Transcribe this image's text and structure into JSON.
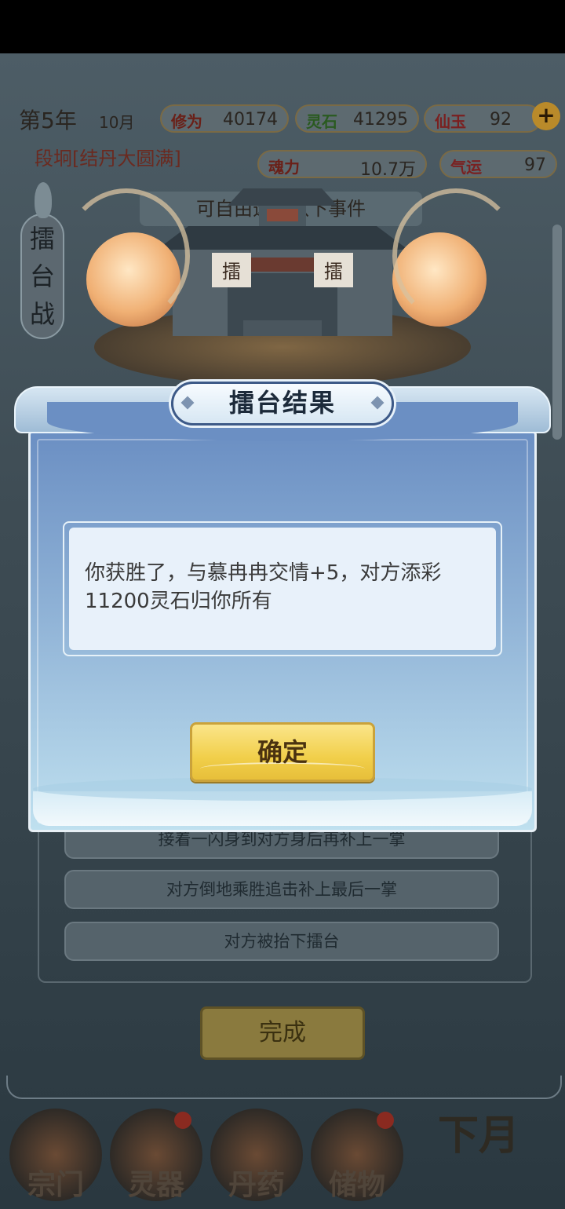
{
  "hud": {
    "year": "第5年",
    "month": "10月",
    "stats": [
      {
        "key": "修为",
        "value": "40174",
        "color": "#6a2018"
      },
      {
        "key": "灵石",
        "value": "41295",
        "color": "#2a5a20"
      },
      {
        "key": "仙玉",
        "value": "92",
        "color": "#7a2020"
      }
    ],
    "stats2": [
      {
        "key": "魂力",
        "value": "10.7万",
        "color": "#6a2018"
      },
      {
        "key": "气运",
        "value": "97",
        "color": "#7a2020"
      }
    ],
    "realm": "段坰[结丹大圆满]",
    "event_bar": "可自由选择以下事件"
  },
  "arena_tag": [
    "擂",
    "台",
    "战"
  ],
  "banners": [
    "擂",
    "擂"
  ],
  "background_options": [
    "接着一闪身到对方身后再补上一掌",
    "对方倒地乘胜追击补上最后一掌",
    "对方被抬下擂台"
  ],
  "done_button": "完成",
  "bottom_nav": [
    "宗门",
    "灵器",
    "丹药",
    "储物"
  ],
  "next_month": "下月",
  "dialog": {
    "title": "擂台结果",
    "message": "你获胜了，与慕冉冉交情+5，对方添彩11200灵石归你所有",
    "confirm": "确定"
  }
}
